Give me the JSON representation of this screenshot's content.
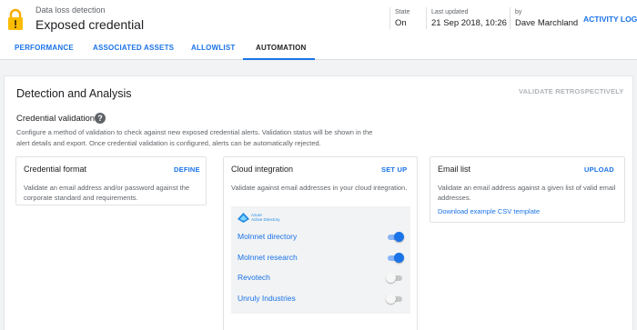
{
  "header": {
    "subtitle": "Data loss detection",
    "title": "Exposed credential",
    "state_label": "State",
    "state_value": "On",
    "updated_label": "Last updated",
    "updated_value": "21 Sep 2018, 10:26",
    "by_label": "by",
    "by_value": "Dave Marchland",
    "activity_log": "ACTIVITY LOG"
  },
  "tabs": [
    {
      "label": "PERFORMANCE",
      "active": false
    },
    {
      "label": "ASSOCIATED ASSETS",
      "active": false
    },
    {
      "label": "ALLOWLIST",
      "active": false
    },
    {
      "label": "AUTOMATION",
      "active": true
    }
  ],
  "section": {
    "title": "Detection and Analysis",
    "validate_action": "VALIDATE RETROSPECTIVELY",
    "cv_label": "Credential validation",
    "help_icon": "?",
    "description": "Configure a method of validation to check against new exposed credential alerts. Validation status will be shown in the alert details and export. Once credential validation is configured, alerts can be automatically rejected."
  },
  "cards": {
    "format": {
      "title": "Credential format",
      "action": "DEFINE",
      "desc": "Validate an email address and/or password against the corporate standard and requirements."
    },
    "cloud": {
      "title": "Cloud integration",
      "action": "SET UP",
      "desc": "Validate against email addresses in your cloud integration.",
      "provider_line1": "Azure",
      "provider_line2": "Active Directory",
      "orgs": [
        {
          "name": "Molnnet directory",
          "enabled": true
        },
        {
          "name": "Molnnet research",
          "enabled": true
        },
        {
          "name": "Revotech",
          "enabled": false
        },
        {
          "name": "Unruly Industries",
          "enabled": false
        }
      ]
    },
    "email": {
      "title": "Email list",
      "action": "UPLOAD",
      "desc": "Validate an email address against a given list of valid email addresses.",
      "link": "Download example CSV template"
    }
  },
  "colors": {
    "accent": "#1a73e8",
    "icon_yellow": "#fbbc04",
    "disabled_text": "#b0b4b9"
  }
}
